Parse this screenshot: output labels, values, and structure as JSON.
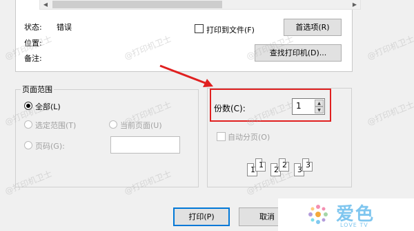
{
  "printer": {
    "status_label": "状态:",
    "status_value": "错误",
    "location_label": "位置:",
    "comment_label": "备注:",
    "print_to_file_label": "打印到文件(F)",
    "preferences_button": "首选项(R)",
    "find_printer_button": "查找打印机(D)..."
  },
  "page_range": {
    "title": "页面范围",
    "all_label": "全部(L)",
    "selection_label": "选定范围(T)",
    "current_page_label": "当前页面(U)",
    "pages_label": "页码(G):"
  },
  "copies": {
    "label": "份数(C):",
    "value": "1",
    "collate_label": "自动分页(O)",
    "collate_pages": [
      "1",
      "1",
      "2",
      "2",
      "3",
      "3"
    ]
  },
  "buttons": {
    "print": "打印(P)",
    "cancel": "取消"
  },
  "watermark_text": "@打印机卫士",
  "logo": {
    "text": "爱色",
    "sub": "LOVE TV"
  }
}
